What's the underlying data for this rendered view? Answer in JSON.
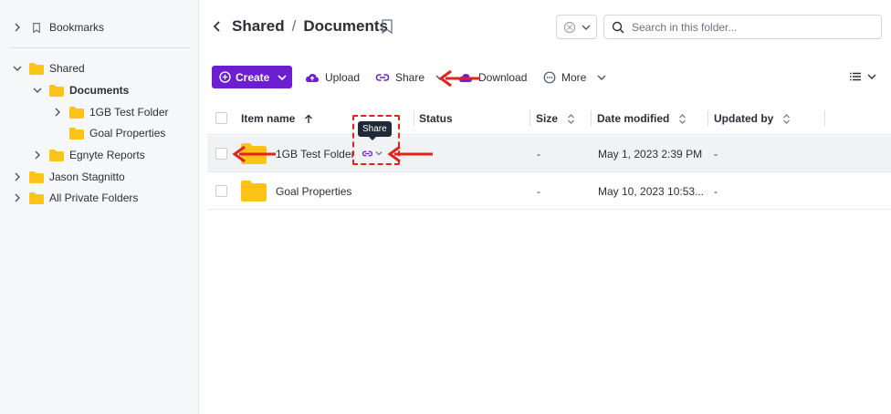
{
  "sidebar": {
    "bookmarks": "Bookmarks",
    "shared": "Shared",
    "documents": "Documents",
    "test_folder": "1GB Test Folder",
    "goal_properties": "Goal Properties",
    "egnyte_reports": "Egnyte Reports",
    "jason": "Jason Stagnitto",
    "private": "All Private Folders"
  },
  "header": {
    "crumb_parent": "Shared",
    "crumb_sep": "/",
    "crumb_current": "Documents",
    "search_placeholder": "Search in this folder..."
  },
  "toolbar": {
    "create": "Create",
    "upload": "Upload",
    "share": "Share",
    "download": "Download",
    "more": "More"
  },
  "table": {
    "columns": [
      "Item name",
      "Status",
      "Size",
      "Date modified",
      "Updated by"
    ],
    "rows": [
      {
        "name": "1GB Test Folder",
        "size": "-",
        "date": "May 1, 2023 2:39 PM",
        "updated_by": "-"
      },
      {
        "name": "Goal Properties",
        "size": "-",
        "date": "May 10, 2023 10:53...",
        "updated_by": "-"
      }
    ]
  },
  "tooltip": "Share",
  "colors": {
    "accent": "#6d1ed1",
    "folder": "#fcc419",
    "annotation": "#e0241d"
  }
}
